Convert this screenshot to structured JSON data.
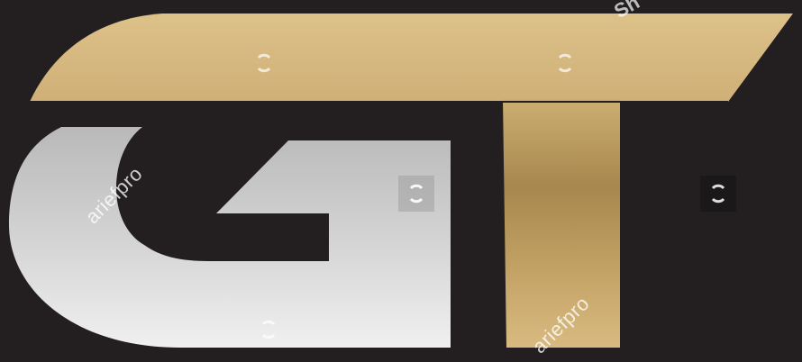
{
  "logo": {
    "letters": "GT",
    "colors": {
      "background": "#231f20",
      "gold_light": "#dcc08a",
      "gold_mid": "#c7a566",
      "gold_dark": "#a3834a",
      "silver_light": "#ededed",
      "silver_dark": "#bfbfbf"
    }
  },
  "watermarks": {
    "text_1": "ariefpro",
    "text_2": "ariefpro",
    "text_top": "Sh",
    "icon": "refresh-icon"
  }
}
